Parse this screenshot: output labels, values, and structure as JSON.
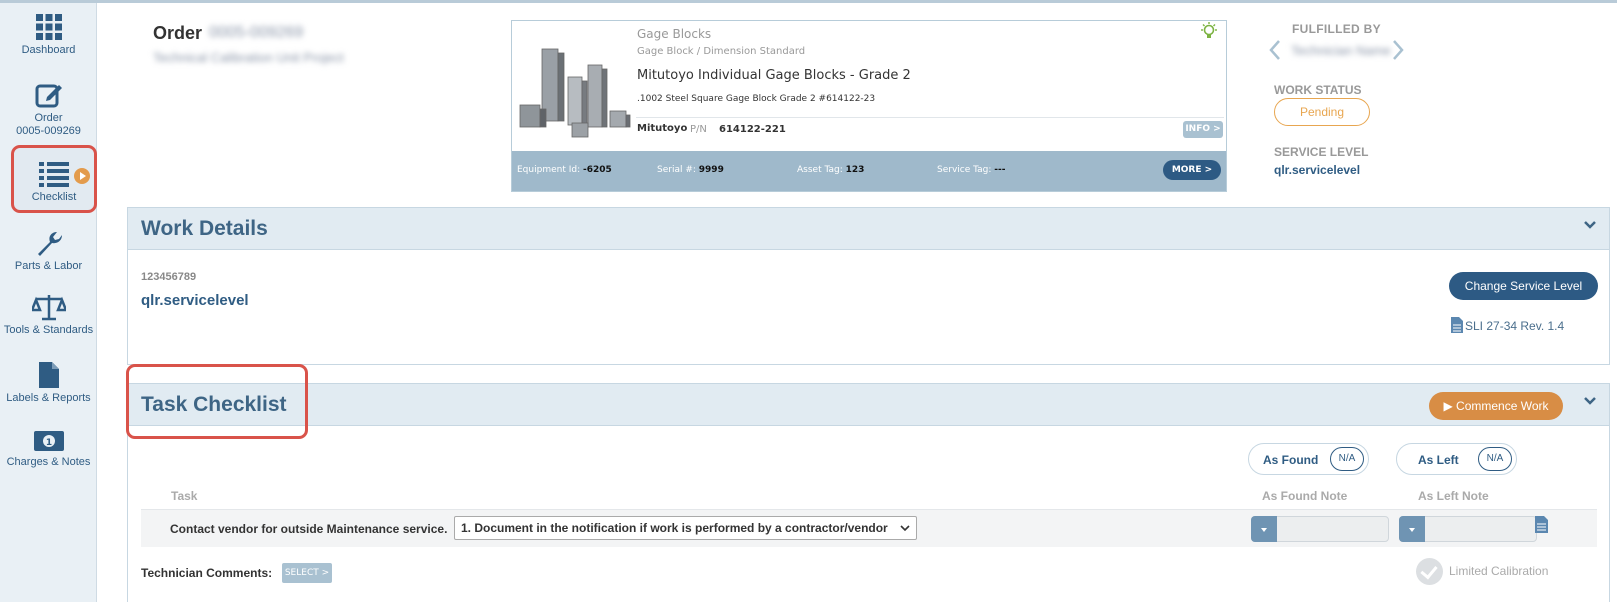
{
  "sidebar": {
    "items": [
      {
        "label": "Dashboard"
      },
      {
        "label": "Order",
        "sub": "0005-009269"
      },
      {
        "label": "Checklist"
      },
      {
        "label": "Parts & Labor"
      },
      {
        "label": "Tools & Standards"
      },
      {
        "label": "Labels & Reports"
      },
      {
        "label": "Charges & Notes"
      }
    ]
  },
  "order": {
    "title": "Order",
    "number": "0005-009269",
    "subtitle": "Technical Calibration Unit Project"
  },
  "equipment": {
    "category": "Gage Blocks",
    "subcategory": "Gage Block / Dimension Standard",
    "name": "Mitutoyo Individual Gage Blocks - Grade 2",
    "description": ".1002 Steel Square Gage Block Grade 2 #614122-23",
    "manufacturer": "Mitutoyo",
    "pn_label": "P/N",
    "pn": "614122-221",
    "info_label": "INFO >",
    "more_label": "MORE >",
    "fields": [
      {
        "label": "Equipment Id:",
        "value": "-6205"
      },
      {
        "label": "Serial #:",
        "value": "9999"
      },
      {
        "label": "Asset Tag:",
        "value": "123"
      },
      {
        "label": "Service Tag:",
        "value": "---"
      }
    ]
  },
  "status": {
    "fulfilled_by_label": "FULFILLED BY",
    "fulfilled_by": "Technician Name",
    "work_status_label": "WORK STATUS",
    "work_status": "Pending",
    "service_level_label": "SERVICE LEVEL",
    "service_level": "qlr.servicelevel"
  },
  "work_details": {
    "title": "Work Details",
    "code": "123456789",
    "level": "qlr.servicelevel",
    "change_button": "Change Service Level",
    "sli_link": "SLI 27-34 Rev. 1.4"
  },
  "task_checklist": {
    "title": "Task Checklist",
    "commence_button": "Commence Work",
    "as_found_label": "As Found",
    "as_left_label": "As Left",
    "na_label": "N/A",
    "task_header": "Task",
    "as_found_note_header": "As Found Note",
    "as_left_note_header": "As Left Note",
    "rows": [
      {
        "task": "Contact vendor for outside Maintenance service.",
        "selected": "1. Document in the notification if work is performed by a contractor/vendor"
      }
    ],
    "tech_comments_label": "Technician Comments:",
    "select_button": "SELECT >",
    "limited_calibration": "Limited Calibration"
  },
  "colors": {
    "accent": "#2d5a84",
    "orange": "#d88d45",
    "highlight": "#d9534a"
  }
}
